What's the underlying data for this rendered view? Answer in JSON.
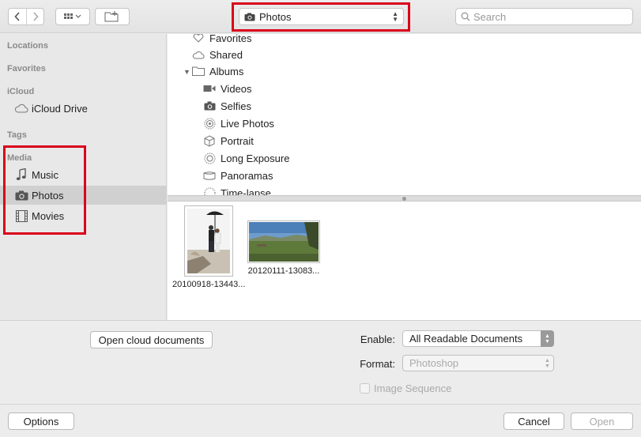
{
  "toolbar": {
    "back_icon": "chevron-left-icon",
    "forward_icon": "chevron-right-icon",
    "view_icon": "icon-grid-icon",
    "new_folder_icon": "new-folder-icon",
    "location": "Photos",
    "search_placeholder": "Search"
  },
  "sidebar": {
    "sections": [
      "Locations",
      "Favorites",
      "iCloud",
      "Tags",
      "Media"
    ],
    "icloud_item": "iCloud Drive",
    "media_items": [
      {
        "label": "Music",
        "icon": "music-note-icon"
      },
      {
        "label": "Photos",
        "icon": "camera-icon",
        "selected": true
      },
      {
        "label": "Movies",
        "icon": "film-icon"
      }
    ]
  },
  "outline": {
    "items": [
      {
        "label": "Favorites",
        "icon": "heart-icon"
      },
      {
        "label": "Shared",
        "icon": "cloud-icon"
      },
      {
        "label": "Albums",
        "icon": "folder-icon"
      },
      {
        "label": "Videos",
        "icon": "video-camera-icon"
      },
      {
        "label": "Selfies",
        "icon": "camera-icon"
      },
      {
        "label": "Live Photos",
        "icon": "live-photo-icon"
      },
      {
        "label": "Portrait",
        "icon": "cube-icon"
      },
      {
        "label": "Long Exposure",
        "icon": "long-exposure-icon"
      },
      {
        "label": "Panoramas",
        "icon": "panorama-icon"
      },
      {
        "label": "Time-lapse",
        "icon": "time-lapse-icon"
      }
    ]
  },
  "thumbnails": [
    {
      "caption": "20100918-13443..."
    },
    {
      "caption": "20120111-13083..."
    }
  ],
  "options": {
    "open_cloud_label": "Open cloud documents",
    "enable_label": "Enable:",
    "enable_value": "All Readable Documents",
    "format_label": "Format:",
    "format_value": "Photoshop",
    "image_sequence_label": "Image Sequence"
  },
  "footer": {
    "options_label": "Options",
    "cancel_label": "Cancel",
    "open_label": "Open"
  },
  "colors": {
    "highlight": "#d9001b",
    "selection": "#d0d0d0"
  }
}
